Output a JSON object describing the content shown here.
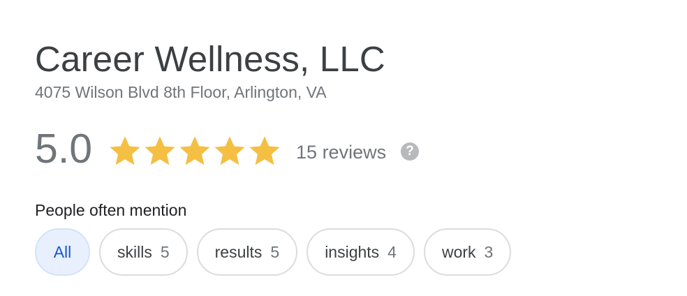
{
  "business": {
    "name": "Career Wellness, LLC",
    "address": "4075 Wilson Blvd 8th Floor, Arlington, VA"
  },
  "rating": {
    "score": "5.0",
    "stars": 5,
    "max_stars": 5,
    "star_color": "#f4bf42",
    "reviews_label": "15 reviews",
    "help_icon": "?"
  },
  "mentions": {
    "title": "People often mention",
    "chips": [
      {
        "label": "All",
        "count": "",
        "selected": true
      },
      {
        "label": "skills",
        "count": "5",
        "selected": false
      },
      {
        "label": "results",
        "count": "5",
        "selected": false
      },
      {
        "label": "insights",
        "count": "4",
        "selected": false
      },
      {
        "label": "work",
        "count": "3",
        "selected": false
      }
    ]
  },
  "colors": {
    "selected_chip_bg": "#e8f0fe",
    "selected_chip_text": "#1a56c6",
    "chip_border": "#dadce0"
  }
}
